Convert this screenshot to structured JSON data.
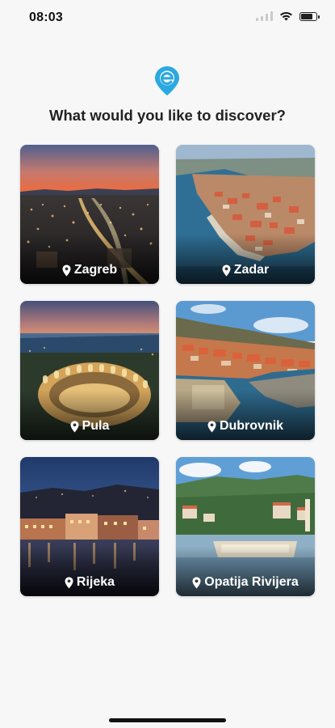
{
  "status_bar": {
    "time": "08:03"
  },
  "title": "What would you like to discover?",
  "destinations": [
    {
      "label": "Zagreb"
    },
    {
      "label": "Zadar"
    },
    {
      "label": "Pula"
    },
    {
      "label": "Dubrovnik"
    },
    {
      "label": "Rijeka"
    },
    {
      "label": "Opatija Rivijera"
    }
  ],
  "colors": {
    "brand": "#2aa9e0",
    "title": "#222222",
    "background": "#f7f7f7"
  },
  "icons": {
    "logo": "brand-pin-logo-icon",
    "card_pin": "map-pin-icon"
  }
}
